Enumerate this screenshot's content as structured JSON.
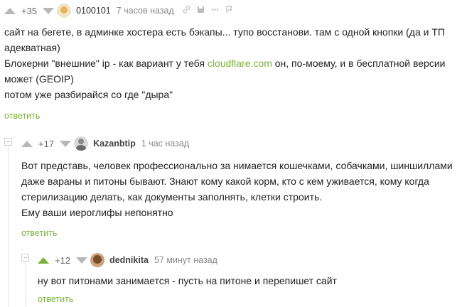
{
  "c1": {
    "rating": "+35",
    "author": "0100101",
    "time": "7 часов назад",
    "lines": [
      "сайт на бегете, в админке хостера есть бэкапы... тупо восстанови. там с одной кнопки (да и ТП",
      "адекватная)"
    ],
    "line3_pre": "Блокерни \"внешние\" ip - как вариант у тебя ",
    "line3_link": "cloudflare.com",
    "line3_post": " он, по-моему, и в бесплатной версии",
    "line4": "может (GEOIP)",
    "line5": "потом уже разбирайся со где \"дыра\"",
    "reply": "ответить"
  },
  "c2": {
    "rating": "+17",
    "author": "Kazanbtip",
    "time": "1 час назад",
    "lines": [
      "Вот представь, человек профессионально за нимается кошечками, собачками, шиншиллами",
      "даже вараны и питоны бывают. Знают кому какой корм, кто с кем уживается, кому когда",
      "стерилизацию делать, как документы заполнять, клетки строить.",
      "Ему ваши иероглифы непонятно"
    ],
    "reply": "ответить"
  },
  "c3": {
    "rating": "+12",
    "author": "dednikita",
    "time": "57 минут назад",
    "lines": [
      "ну вот питонами занимается - пусть на питоне и перепишет сайт"
    ],
    "reply": "ответить"
  },
  "colors": {
    "accent": "#7bb33b",
    "muted": "#b8b8b8"
  },
  "icons": [
    "arrow-up-icon",
    "arrow-down-icon",
    "link-icon",
    "save-icon",
    "more-icon",
    "flag-icon"
  ]
}
